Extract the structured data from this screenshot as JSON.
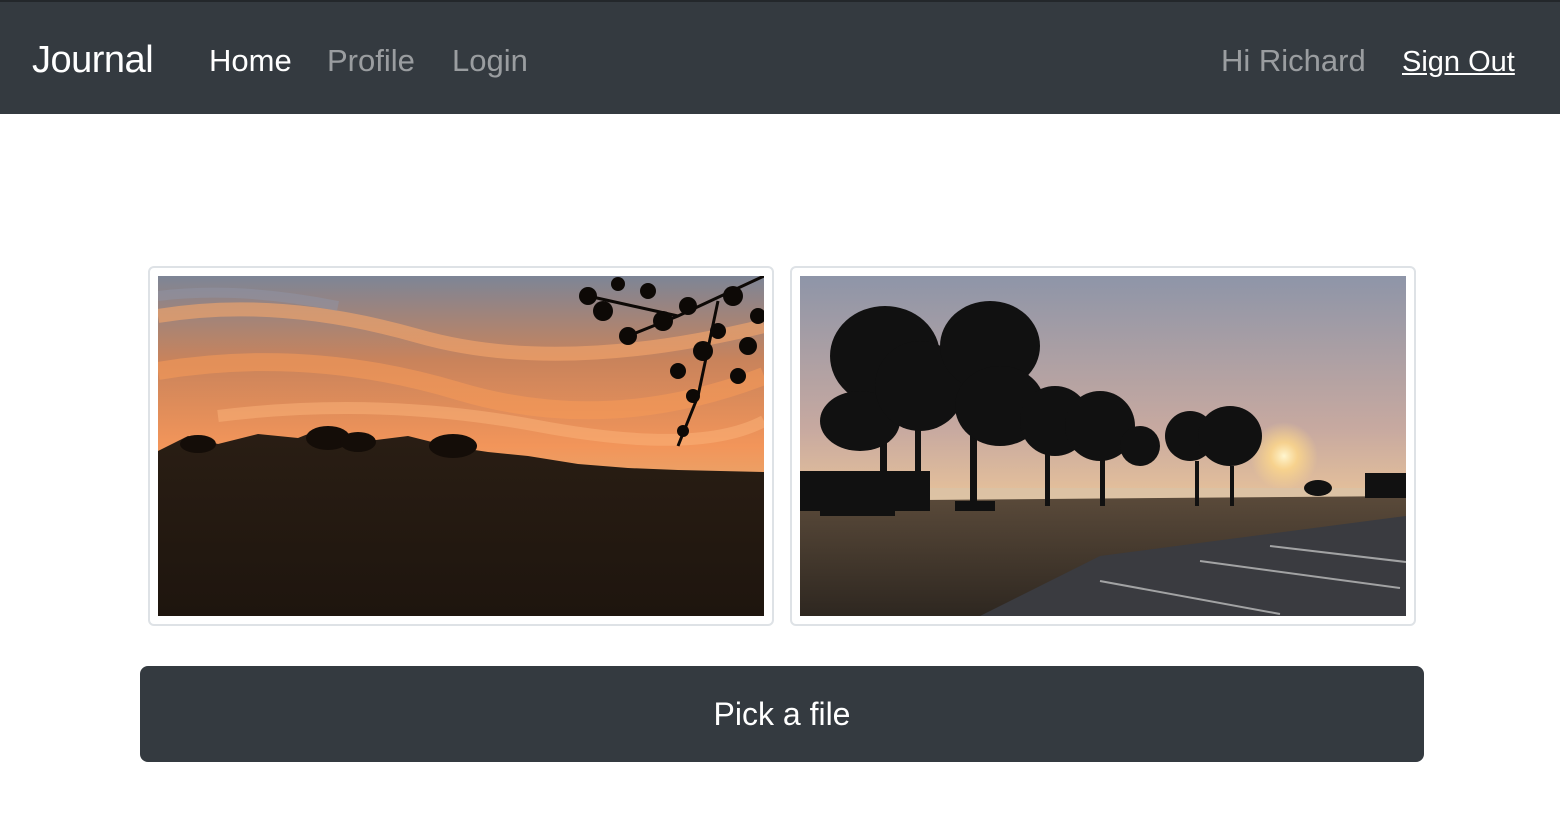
{
  "navbar": {
    "brand": "Journal",
    "links": [
      {
        "label": "Home",
        "active": true
      },
      {
        "label": "Profile",
        "active": false
      },
      {
        "label": "Login",
        "active": false
      }
    ],
    "greeting": "Hi Richard",
    "signout_label": "Sign Out"
  },
  "gallery": {
    "images": [
      {
        "subject": "sunset-hillside-photo"
      },
      {
        "subject": "foggy-park-sunrise-photo"
      }
    ]
  },
  "actions": {
    "pick_file_label": "Pick a file"
  },
  "colors": {
    "navbar_bg": "#343a40",
    "button_bg": "#343a40",
    "nav_inactive": "rgba(255,255,255,0.5)",
    "nav_active": "#ffffff"
  }
}
